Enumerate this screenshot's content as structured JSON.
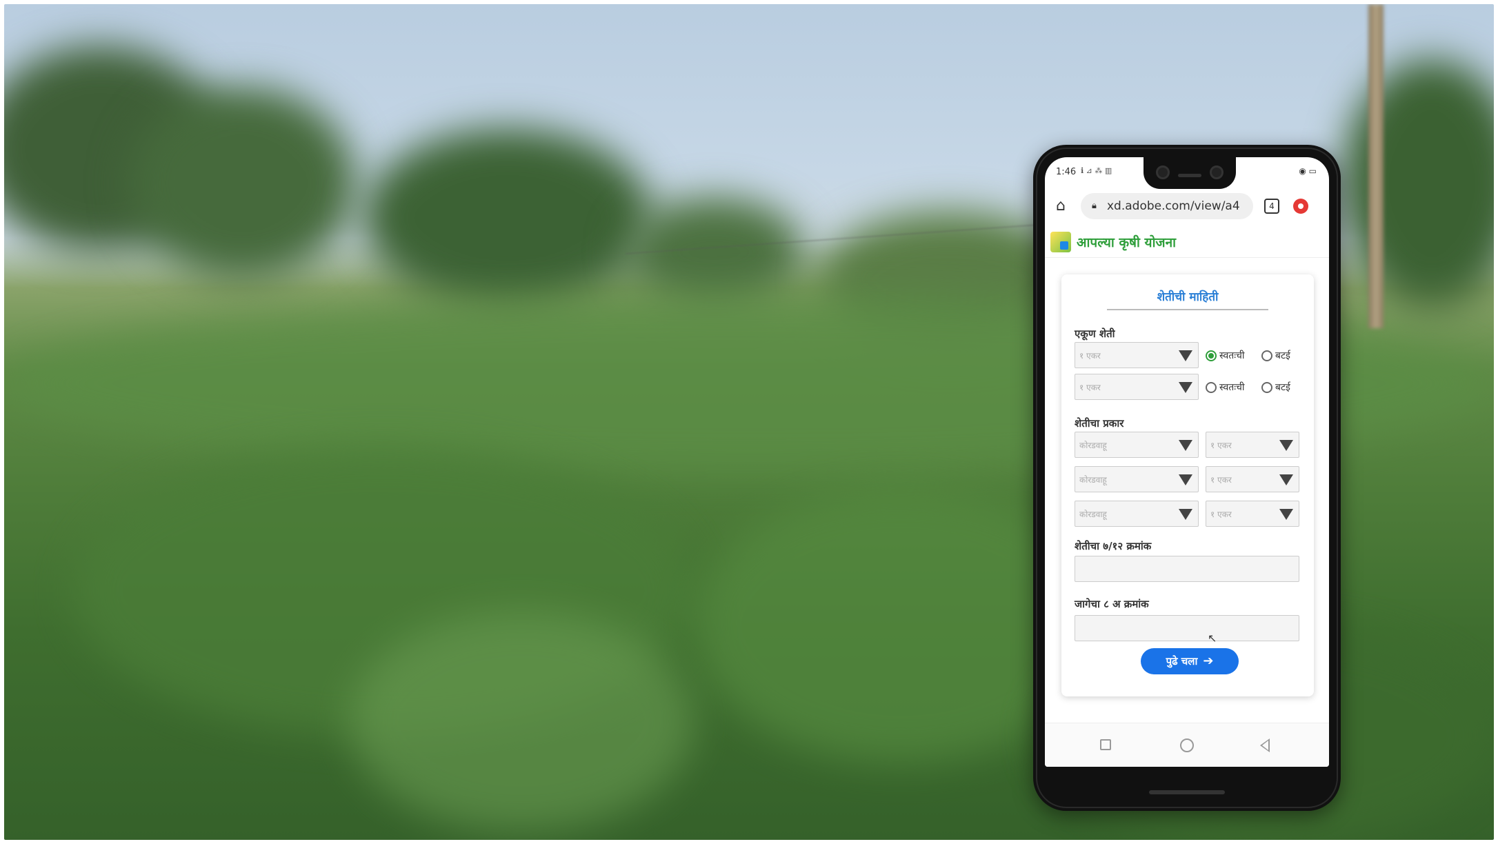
{
  "status_bar": {
    "time": "1:46",
    "signal": "ℹ ⊿ ⁂ ▥",
    "battery": "◉ ▭"
  },
  "browser": {
    "url": "xd.adobe.com/view/a4",
    "tab_count": "4"
  },
  "app": {
    "title": "आपल्या कृषी योजना"
  },
  "form": {
    "title": "शेतीची माहिती",
    "total_farm_label": "एकूण शेती",
    "rows": [
      {
        "placeholder": "१ एकर",
        "radio_own": "स्वतःची",
        "radio_share": "बटई",
        "own_selected": true
      },
      {
        "placeholder": "१ एकर",
        "radio_own": "स्वतःची",
        "radio_share": "बटई",
        "own_selected": false
      }
    ],
    "farm_type_label": "शेतीचा प्रकार",
    "crop_rows": [
      {
        "crop_placeholder": "कोरडवाहू",
        "area_placeholder": "१ एकर"
      },
      {
        "crop_placeholder": "कोरडवाहू",
        "area_placeholder": "१ एकर"
      },
      {
        "crop_placeholder": "कोरडवाहू",
        "area_placeholder": "१ एकर"
      }
    ],
    "survey_label": "शेतीचा ७/१२ क्रमांक",
    "place_label": "जागेचा ८ अ क्रमांक",
    "next_label": "पुढे चला",
    "next_arrow": "➔"
  },
  "colors": {
    "accent": "#1a73e8",
    "brand_green": "#2e9e3a",
    "title_blue": "#2a7fd6"
  },
  "icons": {
    "home": "home-icon",
    "lock": "lock-icon",
    "tabs": "tabs-icon",
    "record": "record-icon"
  }
}
